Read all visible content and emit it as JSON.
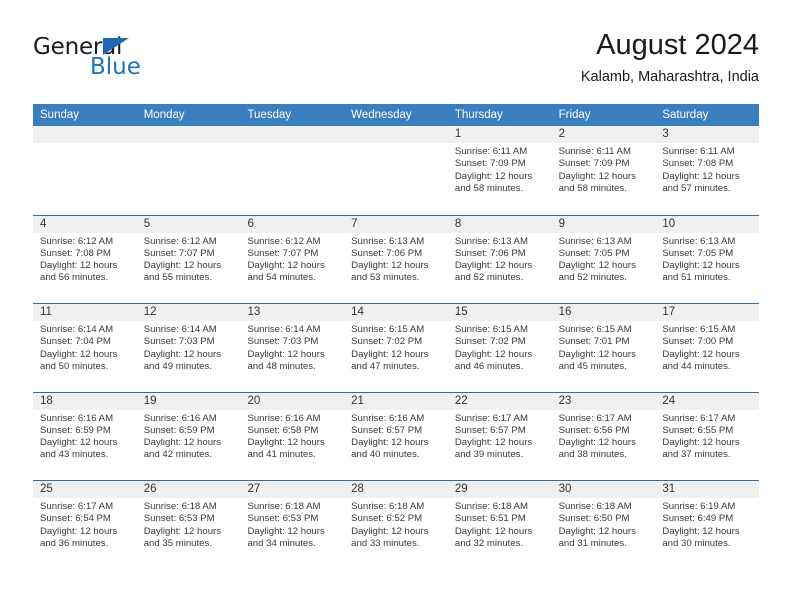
{
  "brand": {
    "name_top": "General",
    "name_bottom": "Blue",
    "accent_color": "#1b75bb",
    "triangle_color": "#1b69b0"
  },
  "header": {
    "title": "August 2024",
    "subtitle": "Kalamb, Maharashtra, India"
  },
  "calendar": {
    "header_bg": "#3a7ebf",
    "row_divider_color": "#2f6ea5",
    "band_bg": "#f0f0f0",
    "weekdays": [
      "Sunday",
      "Monday",
      "Tuesday",
      "Wednesday",
      "Thursday",
      "Friday",
      "Saturday"
    ],
    "weeks": [
      [
        {
          "day": "",
          "info": ""
        },
        {
          "day": "",
          "info": ""
        },
        {
          "day": "",
          "info": ""
        },
        {
          "day": "",
          "info": ""
        },
        {
          "day": "1",
          "info": "Sunrise: 6:11 AM\nSunset: 7:09 PM\nDaylight: 12 hours\nand 58 minutes."
        },
        {
          "day": "2",
          "info": "Sunrise: 6:11 AM\nSunset: 7:09 PM\nDaylight: 12 hours\nand 58 minutes."
        },
        {
          "day": "3",
          "info": "Sunrise: 6:11 AM\nSunset: 7:08 PM\nDaylight: 12 hours\nand 57 minutes."
        }
      ],
      [
        {
          "day": "4",
          "info": "Sunrise: 6:12 AM\nSunset: 7:08 PM\nDaylight: 12 hours\nand 56 minutes."
        },
        {
          "day": "5",
          "info": "Sunrise: 6:12 AM\nSunset: 7:07 PM\nDaylight: 12 hours\nand 55 minutes."
        },
        {
          "day": "6",
          "info": "Sunrise: 6:12 AM\nSunset: 7:07 PM\nDaylight: 12 hours\nand 54 minutes."
        },
        {
          "day": "7",
          "info": "Sunrise: 6:13 AM\nSunset: 7:06 PM\nDaylight: 12 hours\nand 53 minutes."
        },
        {
          "day": "8",
          "info": "Sunrise: 6:13 AM\nSunset: 7:06 PM\nDaylight: 12 hours\nand 52 minutes."
        },
        {
          "day": "9",
          "info": "Sunrise: 6:13 AM\nSunset: 7:05 PM\nDaylight: 12 hours\nand 52 minutes."
        },
        {
          "day": "10",
          "info": "Sunrise: 6:13 AM\nSunset: 7:05 PM\nDaylight: 12 hours\nand 51 minutes."
        }
      ],
      [
        {
          "day": "11",
          "info": "Sunrise: 6:14 AM\nSunset: 7:04 PM\nDaylight: 12 hours\nand 50 minutes."
        },
        {
          "day": "12",
          "info": "Sunrise: 6:14 AM\nSunset: 7:03 PM\nDaylight: 12 hours\nand 49 minutes."
        },
        {
          "day": "13",
          "info": "Sunrise: 6:14 AM\nSunset: 7:03 PM\nDaylight: 12 hours\nand 48 minutes."
        },
        {
          "day": "14",
          "info": "Sunrise: 6:15 AM\nSunset: 7:02 PM\nDaylight: 12 hours\nand 47 minutes."
        },
        {
          "day": "15",
          "info": "Sunrise: 6:15 AM\nSunset: 7:02 PM\nDaylight: 12 hours\nand 46 minutes."
        },
        {
          "day": "16",
          "info": "Sunrise: 6:15 AM\nSunset: 7:01 PM\nDaylight: 12 hours\nand 45 minutes."
        },
        {
          "day": "17",
          "info": "Sunrise: 6:15 AM\nSunset: 7:00 PM\nDaylight: 12 hours\nand 44 minutes."
        }
      ],
      [
        {
          "day": "18",
          "info": "Sunrise: 6:16 AM\nSunset: 6:59 PM\nDaylight: 12 hours\nand 43 minutes."
        },
        {
          "day": "19",
          "info": "Sunrise: 6:16 AM\nSunset: 6:59 PM\nDaylight: 12 hours\nand 42 minutes."
        },
        {
          "day": "20",
          "info": "Sunrise: 6:16 AM\nSunset: 6:58 PM\nDaylight: 12 hours\nand 41 minutes."
        },
        {
          "day": "21",
          "info": "Sunrise: 6:16 AM\nSunset: 6:57 PM\nDaylight: 12 hours\nand 40 minutes."
        },
        {
          "day": "22",
          "info": "Sunrise: 6:17 AM\nSunset: 6:57 PM\nDaylight: 12 hours\nand 39 minutes."
        },
        {
          "day": "23",
          "info": "Sunrise: 6:17 AM\nSunset: 6:56 PM\nDaylight: 12 hours\nand 38 minutes."
        },
        {
          "day": "24",
          "info": "Sunrise: 6:17 AM\nSunset: 6:55 PM\nDaylight: 12 hours\nand 37 minutes."
        }
      ],
      [
        {
          "day": "25",
          "info": "Sunrise: 6:17 AM\nSunset: 6:54 PM\nDaylight: 12 hours\nand 36 minutes."
        },
        {
          "day": "26",
          "info": "Sunrise: 6:18 AM\nSunset: 6:53 PM\nDaylight: 12 hours\nand 35 minutes."
        },
        {
          "day": "27",
          "info": "Sunrise: 6:18 AM\nSunset: 6:53 PM\nDaylight: 12 hours\nand 34 minutes."
        },
        {
          "day": "28",
          "info": "Sunrise: 6:18 AM\nSunset: 6:52 PM\nDaylight: 12 hours\nand 33 minutes."
        },
        {
          "day": "29",
          "info": "Sunrise: 6:18 AM\nSunset: 6:51 PM\nDaylight: 12 hours\nand 32 minutes."
        },
        {
          "day": "30",
          "info": "Sunrise: 6:18 AM\nSunset: 6:50 PM\nDaylight: 12 hours\nand 31 minutes."
        },
        {
          "day": "31",
          "info": "Sunrise: 6:19 AM\nSunset: 6:49 PM\nDaylight: 12 hours\nand 30 minutes."
        }
      ]
    ]
  }
}
